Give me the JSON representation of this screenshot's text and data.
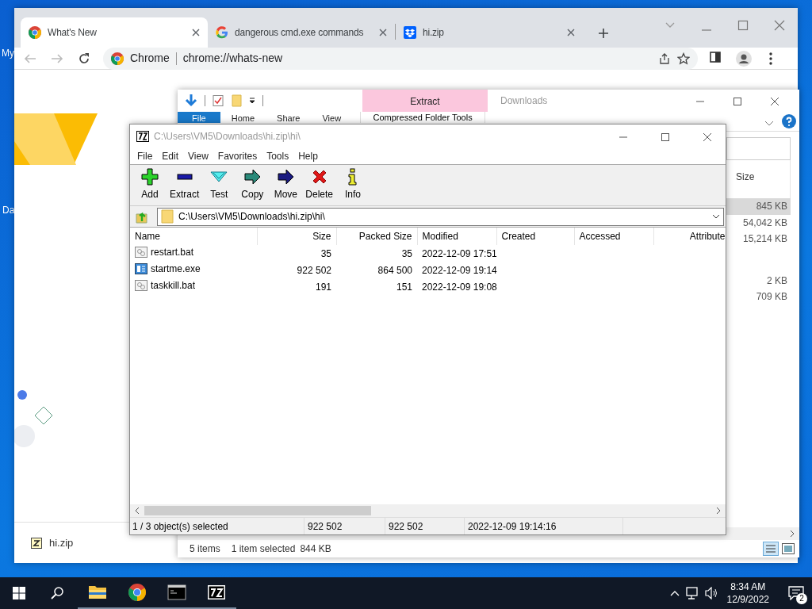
{
  "desktop": {
    "icon_labels": [
      "My",
      "Da"
    ]
  },
  "browser": {
    "tabs": [
      {
        "title": "What's New",
        "kind": "chrome",
        "selected": true
      },
      {
        "title": "dangerous cmd.exe commands",
        "kind": "google",
        "selected": false
      },
      {
        "title": "hi.zip",
        "kind": "dropbox",
        "selected": false
      }
    ],
    "site_chip": "Chrome",
    "url": "chrome://whats-new",
    "download": {
      "file": "hi.zip"
    }
  },
  "explorer": {
    "title": "Downloads",
    "contextual_tab": "Extract",
    "contextual_group": "Compressed Folder Tools",
    "ribbon_tabs": [
      {
        "label": "File",
        "selected": true
      },
      {
        "label": "Home",
        "selected": false
      },
      {
        "label": "Share",
        "selected": false
      },
      {
        "label": "View",
        "selected": false
      }
    ],
    "column": "Size",
    "size_groups": [
      [
        {
          "text": "845 KB",
          "selected": true
        },
        {
          "text": "54,042 KB",
          "selected": false
        },
        {
          "text": "15,214 KB",
          "selected": false
        }
      ],
      [
        {
          "text": "2 KB",
          "selected": false
        },
        {
          "text": "709 KB",
          "selected": false
        }
      ]
    ],
    "status": {
      "count": "5 items",
      "selection": "1 item selected",
      "size": "844 KB"
    }
  },
  "archiver": {
    "title": "C:\\Users\\VM5\\Downloads\\hi.zip\\hi\\",
    "menu": [
      "File",
      "Edit",
      "View",
      "Favorites",
      "Tools",
      "Help"
    ],
    "toolbar": [
      {
        "label": "Add",
        "kind": "add"
      },
      {
        "label": "Extract",
        "kind": "extract"
      },
      {
        "label": "Test",
        "kind": "test"
      },
      {
        "label": "Copy",
        "kind": "copy"
      },
      {
        "label": "Move",
        "kind": "move"
      },
      {
        "label": "Delete",
        "kind": "delete"
      },
      {
        "label": "Info",
        "kind": "info"
      }
    ],
    "path": "C:\\Users\\VM5\\Downloads\\hi.zip\\hi\\",
    "columns": [
      "Name",
      "Size",
      "Packed Size",
      "Modified",
      "Created",
      "Accessed",
      "Attribute"
    ],
    "rows": [
      {
        "name": "restart.bat",
        "kind": "script",
        "size": "35",
        "packed": "35",
        "modified": "2022-12-09 17:51"
      },
      {
        "name": "startme.exe",
        "kind": "program",
        "size": "922 502",
        "packed": "864 500",
        "modified": "2022-12-09 19:14"
      },
      {
        "name": "taskkill.bat",
        "kind": "script",
        "size": "191",
        "packed": "151",
        "modified": "2022-12-09 19:08"
      }
    ],
    "status": [
      "1 / 3 object(s) selected",
      "922 502",
      "922 502",
      "2022-12-09 19:14:16"
    ]
  },
  "taskbar": {
    "apps": [
      {
        "kind": "folder"
      },
      {
        "kind": "chrome"
      },
      {
        "kind": "terminal"
      },
      {
        "kind": "archiver"
      }
    ],
    "time": "8:34 AM",
    "date": "12/9/2022",
    "notifications": "2"
  }
}
